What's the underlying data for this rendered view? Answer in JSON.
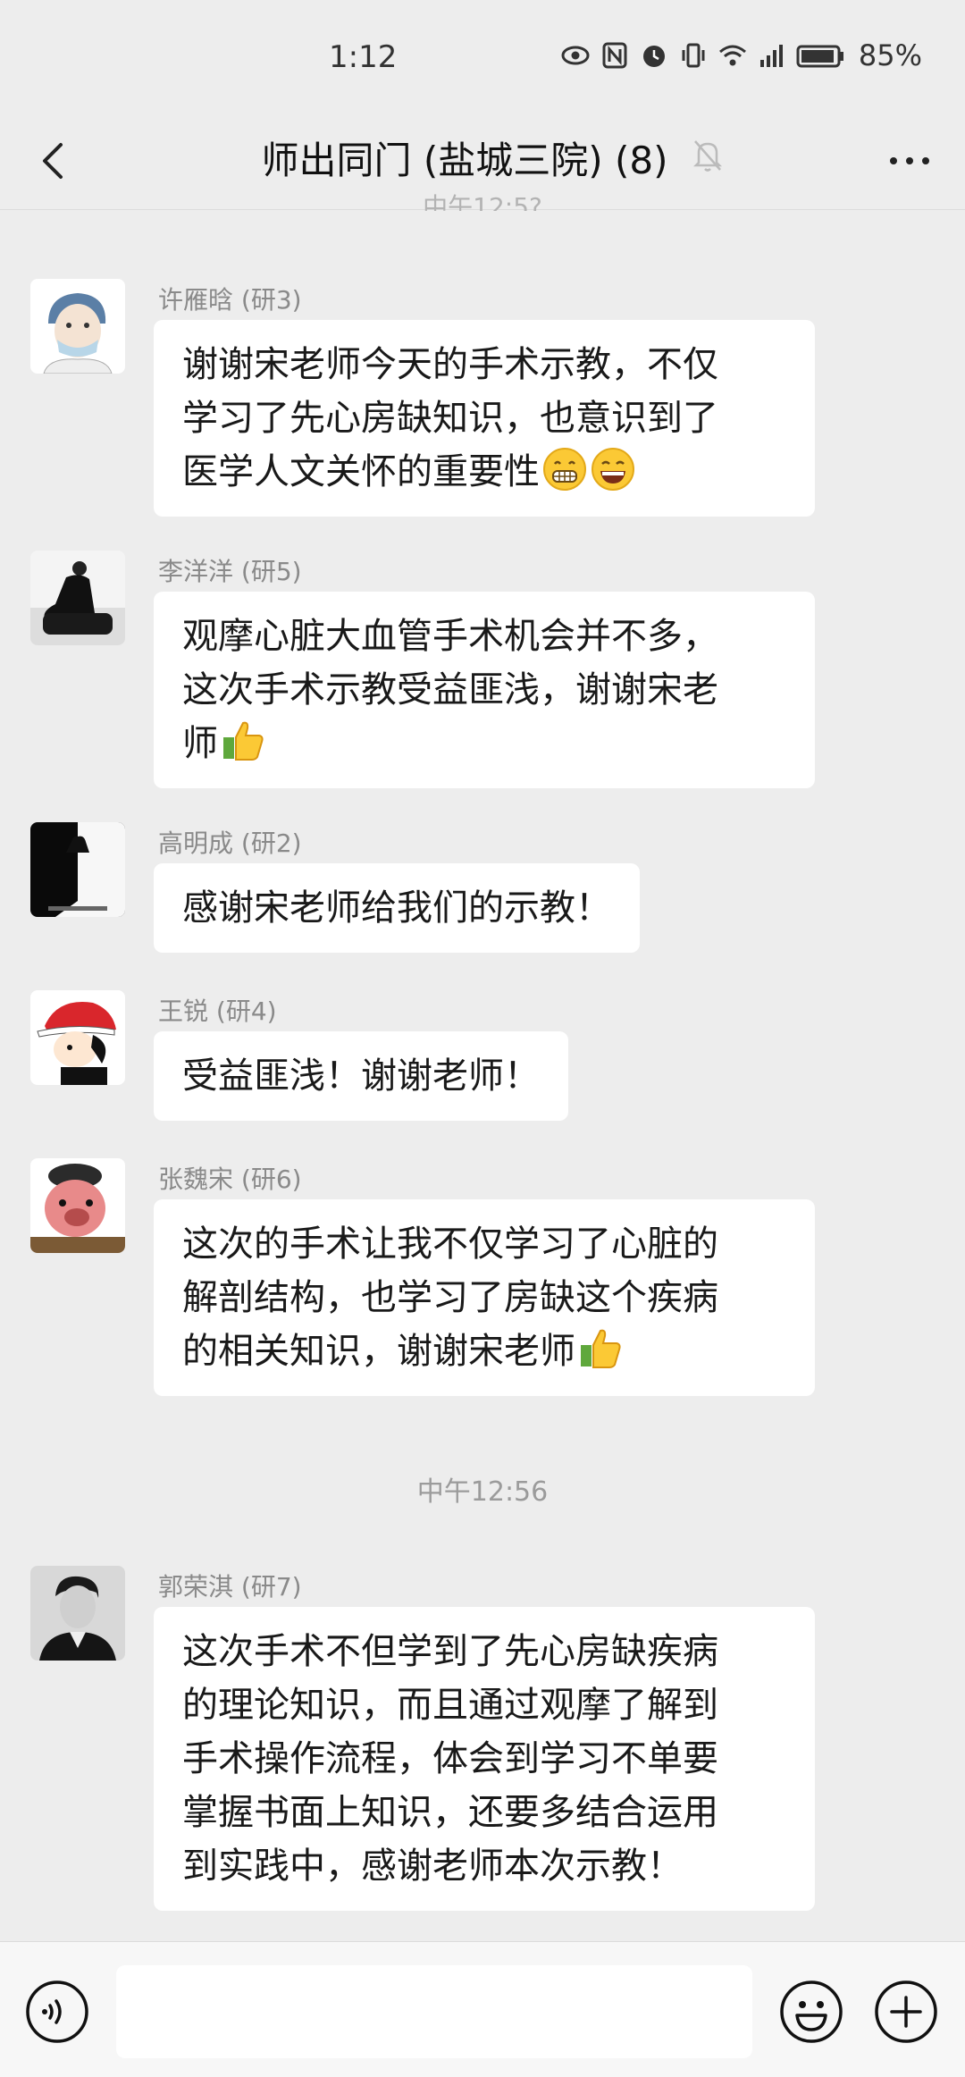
{
  "status_bar": {
    "time": "1:12",
    "battery": "85%"
  },
  "nav": {
    "title": "师出同门 (盐城三院) (8)"
  },
  "top_timestamp": "中午12:5?",
  "messages": [
    {
      "sender": "许雁晗 (研3)",
      "lines": [
        "谢谢宋老师今天的手术示教，不仅",
        "学习了先心房缺知识，也意识到了",
        "医学人文关怀的重要性"
      ]
    },
    {
      "sender": "李洋洋 (研5)",
      "lines": [
        "观摩心脏大血管手术机会并不多，",
        "这次手术示教受益匪浅，谢谢宋老",
        "师"
      ]
    },
    {
      "sender": "高明成 (研2)",
      "lines": [
        "感谢宋老师给我们的示教！"
      ]
    },
    {
      "sender": "王锐 (研4)",
      "lines": [
        "受益匪浅！谢谢老师！"
      ]
    },
    {
      "sender": "张魏宋 (研6)",
      "lines": [
        "这次的手术让我不仅学习了心脏的",
        "解剖结构，也学习了房缺这个疾病",
        "的相关知识，谢谢宋老师"
      ]
    },
    {
      "sender": "郭荣淇 (研7)",
      "lines": [
        "这次手术不但学到了先心房缺疾病",
        "的理论知识，而且通过观摩了解到",
        "手术操作流程，体会到学习不单要",
        "掌握书面上知识，还要多结合运用",
        "到实践中，感谢老师本次示教！"
      ]
    }
  ],
  "time_separator": "中午12:56",
  "input": {
    "value": ""
  },
  "icons": {
    "back": "chevron-left-icon",
    "mute": "bell-slash-icon",
    "more": "ellipsis-icon",
    "voice": "voice-icon",
    "emoji": "smiley-icon",
    "plus": "plus-circle-icon"
  }
}
